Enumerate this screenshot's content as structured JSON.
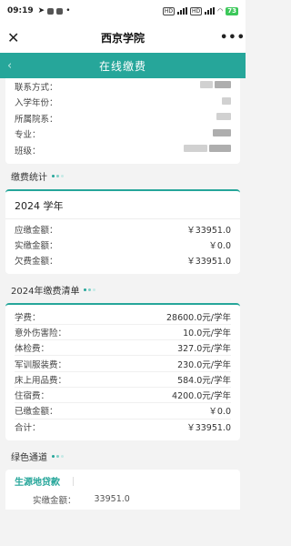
{
  "status_bar": {
    "time": "09:19",
    "battery": "73",
    "signal_label": "5G",
    "chips": [
      "HD",
      "HD"
    ]
  },
  "title_bar": {
    "close_icon": "close-icon",
    "title": "西京学院",
    "more_icon": "more-icon"
  },
  "header": {
    "back_icon": "chevron-left-icon",
    "title": "在线缴费"
  },
  "student_info": [
    {
      "label": "联系方式："
    },
    {
      "label": "入学年份："
    },
    {
      "label": "所属院系："
    },
    {
      "label": "专业："
    },
    {
      "label": "班级："
    }
  ],
  "payment_stats": {
    "section_title": "缴费统计",
    "year_title": "2024 学年",
    "rows": [
      {
        "label": "应缴金额：",
        "value": "￥33951.0"
      },
      {
        "label": "实缴金额：",
        "value": "￥0.0"
      },
      {
        "label": "欠费金额：",
        "value": "￥33951.0"
      }
    ]
  },
  "fee_list": {
    "section_title": "2024年缴费清单",
    "rows": [
      {
        "label": "学费：",
        "value": "28600.0元/学年"
      },
      {
        "label": "意外伤害险：",
        "value": "10.0元/学年"
      },
      {
        "label": "体检费：",
        "value": "327.0元/学年"
      },
      {
        "label": "军训服装费：",
        "value": "230.0元/学年"
      },
      {
        "label": "床上用品费：",
        "value": "584.0元/学年"
      },
      {
        "label": "住宿费：",
        "value": "4200.0元/学年"
      },
      {
        "label": "已缴金额：",
        "value": "￥0.0"
      },
      {
        "label": "合计：",
        "value": "￥33951.0"
      }
    ]
  },
  "green_channel": {
    "section_title": "绿色通道",
    "loan_title": "生源地贷款",
    "paid_label": "实缴金额：",
    "paid_value": "33951.0"
  },
  "colors": {
    "accent": "#26a69a"
  }
}
